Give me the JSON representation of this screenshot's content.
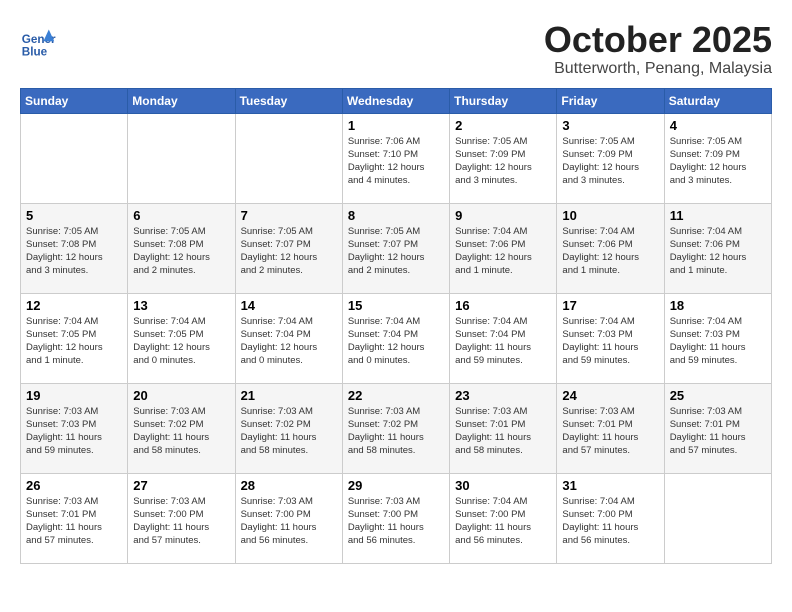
{
  "header": {
    "logo_text_general": "General",
    "logo_text_blue": "Blue",
    "month": "October 2025",
    "location": "Butterworth, Penang, Malaysia"
  },
  "days_of_week": [
    "Sunday",
    "Monday",
    "Tuesday",
    "Wednesday",
    "Thursday",
    "Friday",
    "Saturday"
  ],
  "weeks": [
    [
      {
        "day": "",
        "info": ""
      },
      {
        "day": "",
        "info": ""
      },
      {
        "day": "",
        "info": ""
      },
      {
        "day": "1",
        "info": "Sunrise: 7:06 AM\nSunset: 7:10 PM\nDaylight: 12 hours\nand 4 minutes."
      },
      {
        "day": "2",
        "info": "Sunrise: 7:05 AM\nSunset: 7:09 PM\nDaylight: 12 hours\nand 3 minutes."
      },
      {
        "day": "3",
        "info": "Sunrise: 7:05 AM\nSunset: 7:09 PM\nDaylight: 12 hours\nand 3 minutes."
      },
      {
        "day": "4",
        "info": "Sunrise: 7:05 AM\nSunset: 7:09 PM\nDaylight: 12 hours\nand 3 minutes."
      }
    ],
    [
      {
        "day": "5",
        "info": "Sunrise: 7:05 AM\nSunset: 7:08 PM\nDaylight: 12 hours\nand 3 minutes."
      },
      {
        "day": "6",
        "info": "Sunrise: 7:05 AM\nSunset: 7:08 PM\nDaylight: 12 hours\nand 2 minutes."
      },
      {
        "day": "7",
        "info": "Sunrise: 7:05 AM\nSunset: 7:07 PM\nDaylight: 12 hours\nand 2 minutes."
      },
      {
        "day": "8",
        "info": "Sunrise: 7:05 AM\nSunset: 7:07 PM\nDaylight: 12 hours\nand 2 minutes."
      },
      {
        "day": "9",
        "info": "Sunrise: 7:04 AM\nSunset: 7:06 PM\nDaylight: 12 hours\nand 1 minute."
      },
      {
        "day": "10",
        "info": "Sunrise: 7:04 AM\nSunset: 7:06 PM\nDaylight: 12 hours\nand 1 minute."
      },
      {
        "day": "11",
        "info": "Sunrise: 7:04 AM\nSunset: 7:06 PM\nDaylight: 12 hours\nand 1 minute."
      }
    ],
    [
      {
        "day": "12",
        "info": "Sunrise: 7:04 AM\nSunset: 7:05 PM\nDaylight: 12 hours\nand 1 minute."
      },
      {
        "day": "13",
        "info": "Sunrise: 7:04 AM\nSunset: 7:05 PM\nDaylight: 12 hours\nand 0 minutes."
      },
      {
        "day": "14",
        "info": "Sunrise: 7:04 AM\nSunset: 7:04 PM\nDaylight: 12 hours\nand 0 minutes."
      },
      {
        "day": "15",
        "info": "Sunrise: 7:04 AM\nSunset: 7:04 PM\nDaylight: 12 hours\nand 0 minutes."
      },
      {
        "day": "16",
        "info": "Sunrise: 7:04 AM\nSunset: 7:04 PM\nDaylight: 11 hours\nand 59 minutes."
      },
      {
        "day": "17",
        "info": "Sunrise: 7:04 AM\nSunset: 7:03 PM\nDaylight: 11 hours\nand 59 minutes."
      },
      {
        "day": "18",
        "info": "Sunrise: 7:04 AM\nSunset: 7:03 PM\nDaylight: 11 hours\nand 59 minutes."
      }
    ],
    [
      {
        "day": "19",
        "info": "Sunrise: 7:03 AM\nSunset: 7:03 PM\nDaylight: 11 hours\nand 59 minutes."
      },
      {
        "day": "20",
        "info": "Sunrise: 7:03 AM\nSunset: 7:02 PM\nDaylight: 11 hours\nand 58 minutes."
      },
      {
        "day": "21",
        "info": "Sunrise: 7:03 AM\nSunset: 7:02 PM\nDaylight: 11 hours\nand 58 minutes."
      },
      {
        "day": "22",
        "info": "Sunrise: 7:03 AM\nSunset: 7:02 PM\nDaylight: 11 hours\nand 58 minutes."
      },
      {
        "day": "23",
        "info": "Sunrise: 7:03 AM\nSunset: 7:01 PM\nDaylight: 11 hours\nand 58 minutes."
      },
      {
        "day": "24",
        "info": "Sunrise: 7:03 AM\nSunset: 7:01 PM\nDaylight: 11 hours\nand 57 minutes."
      },
      {
        "day": "25",
        "info": "Sunrise: 7:03 AM\nSunset: 7:01 PM\nDaylight: 11 hours\nand 57 minutes."
      }
    ],
    [
      {
        "day": "26",
        "info": "Sunrise: 7:03 AM\nSunset: 7:01 PM\nDaylight: 11 hours\nand 57 minutes."
      },
      {
        "day": "27",
        "info": "Sunrise: 7:03 AM\nSunset: 7:00 PM\nDaylight: 11 hours\nand 57 minutes."
      },
      {
        "day": "28",
        "info": "Sunrise: 7:03 AM\nSunset: 7:00 PM\nDaylight: 11 hours\nand 56 minutes."
      },
      {
        "day": "29",
        "info": "Sunrise: 7:03 AM\nSunset: 7:00 PM\nDaylight: 11 hours\nand 56 minutes."
      },
      {
        "day": "30",
        "info": "Sunrise: 7:04 AM\nSunset: 7:00 PM\nDaylight: 11 hours\nand 56 minutes."
      },
      {
        "day": "31",
        "info": "Sunrise: 7:04 AM\nSunset: 7:00 PM\nDaylight: 11 hours\nand 56 minutes."
      },
      {
        "day": "",
        "info": ""
      }
    ]
  ]
}
